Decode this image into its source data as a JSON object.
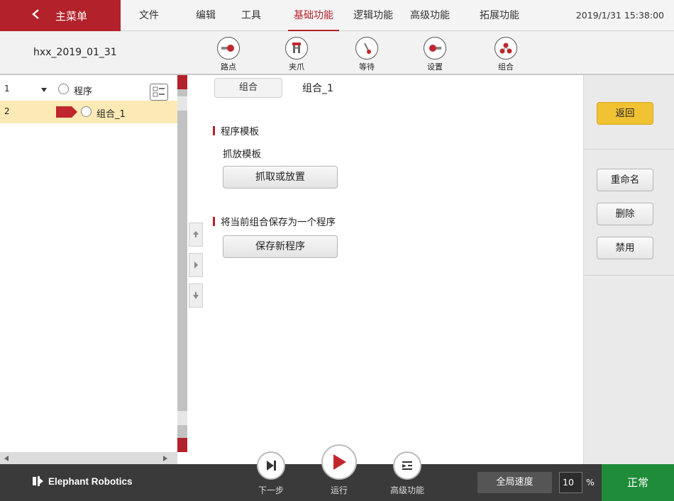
{
  "menubar": {
    "main_menu": "主菜单",
    "items": [
      "文件",
      "编辑",
      "工具",
      "基础功能",
      "逻辑功能",
      "高级功能",
      "拓展功能"
    ],
    "active_item": "基础功能",
    "datetime": "2019/1/31 15:38:00"
  },
  "toolbar": {
    "program_name": "hxx_2019_01_31",
    "tools": [
      {
        "label": "路点",
        "icon": "waypoint-icon"
      },
      {
        "label": "夹爪",
        "icon": "gripper-icon"
      },
      {
        "label": "等待",
        "icon": "wait-icon"
      },
      {
        "label": "设置",
        "icon": "settings-icon"
      },
      {
        "label": "组合",
        "icon": "group-icon"
      }
    ]
  },
  "tree": {
    "rows": [
      {
        "num": "1",
        "label": "程序",
        "icon": "program-icon"
      },
      {
        "num": "2",
        "label": "组合_1",
        "icon": "group-node-icon",
        "selected": true
      }
    ]
  },
  "content": {
    "tab_chip": "组合",
    "node_name": "组合_1",
    "template_section": "程序模板",
    "template_subhead": "抓放模板",
    "pick_place_button": "抓取或放置",
    "save_section": "将当前组合保存为一个程序",
    "save_button": "保存新程序"
  },
  "right_panel": {
    "back": "返回",
    "rename": "重命名",
    "delete": "删除",
    "disable": "禁用"
  },
  "bottombar": {
    "brand": "Elephant Robotics",
    "next_step": "下一步",
    "run": "运行",
    "advanced": "高级功能",
    "speed_label": "全局速度",
    "speed_value": "10",
    "speed_unit": "%",
    "status": "正常",
    "colors": {
      "accent": "#b3212a",
      "status_ok": "#1f8c3a",
      "highlight": "#f1c232"
    }
  }
}
